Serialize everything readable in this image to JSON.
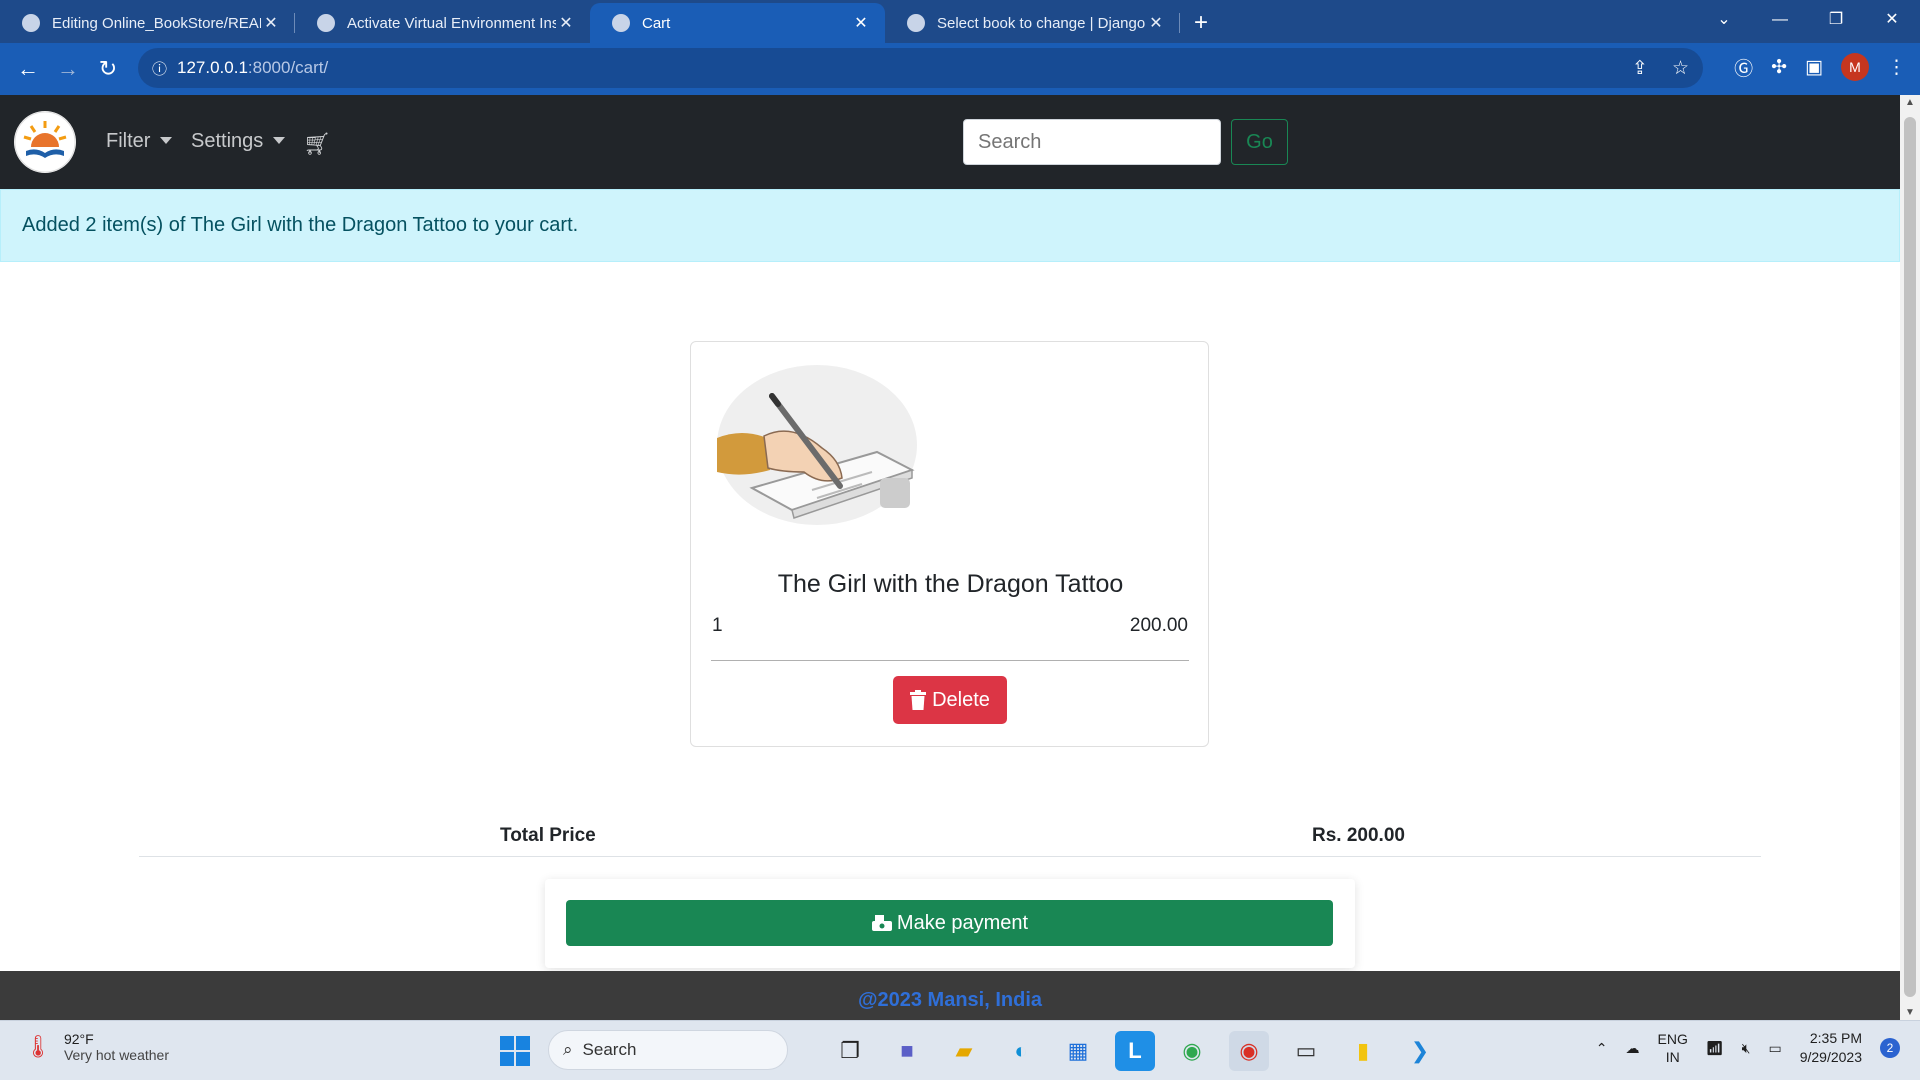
{
  "browser": {
    "tabs": [
      {
        "title": "Editing Online_BookStore/READM",
        "active": false
      },
      {
        "title": "Activate Virtual Environment Inst",
        "active": false
      },
      {
        "title": "Cart",
        "active": true
      },
      {
        "title": "Select book to change | Django",
        "active": false
      }
    ],
    "url_host": "127.0.0.1",
    "url_path": ":8000/cart/",
    "profile_initial": "M"
  },
  "navbar": {
    "filter_label": "Filter",
    "settings_label": "Settings",
    "search_placeholder": "Search",
    "go_label": "Go"
  },
  "alert": {
    "message": "Added 2 item(s) of The Girl with the Dragon Tattoo to your cart."
  },
  "cart": {
    "item": {
      "title": "The Girl with the Dragon Tattoo",
      "quantity": "1",
      "price": "200.00",
      "delete_label": "Delete"
    },
    "total_label": "Total Price",
    "total_value": "Rs. 200.00",
    "pay_label": "Make payment"
  },
  "footer": {
    "copyright": "@2023 Mansi, India"
  },
  "taskbar": {
    "temperature": "92°F",
    "weather_desc": "Very hot weather",
    "search_label": "Search",
    "lang_top": "ENG",
    "lang_bottom": "IN",
    "time": "2:35 PM",
    "date": "9/29/2023",
    "notification_count": "2"
  },
  "colors": {
    "navbar_bg": "#212529",
    "alert_bg": "#cff4fc",
    "delete_red": "#dc3545",
    "pay_green": "#198754",
    "browser_blue": "#1a5db6"
  }
}
